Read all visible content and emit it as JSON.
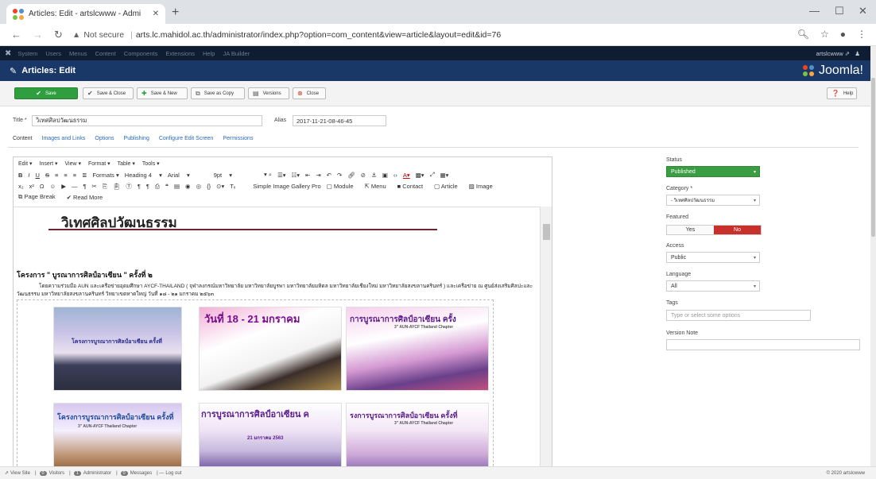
{
  "browser": {
    "tab_title": "Articles: Edit - artslcwww - Admi",
    "new_tab": "+",
    "not_secure": "Not secure",
    "url": "arts.lc.mahidol.ac.th/administrator/index.php?option=com_content&view=article&layout=edit&id=76"
  },
  "jnav": {
    "items": [
      "System",
      "Users",
      "Menus",
      "Content",
      "Components",
      "Extensions",
      "Help",
      "JA Builder"
    ],
    "user": "artslcwww"
  },
  "header": {
    "title": "Articles: Edit",
    "brand": "Joomla!"
  },
  "toolbar": {
    "save": "Save",
    "save_close": "Save & Close",
    "save_new": "Save & New",
    "save_copy": "Save as Copy",
    "versions": "Versions",
    "close": "Close",
    "help": "Help"
  },
  "form": {
    "title_label": "Title *",
    "title_value": "วิเทศศิลปวัฒนธรรม",
    "alias_label": "Alias",
    "alias_value": "2017-11-21-08-46-45"
  },
  "tabs": [
    "Content",
    "Images and Links",
    "Options",
    "Publishing",
    "Configure Edit Screen",
    "Permissions"
  ],
  "editor": {
    "menubar": [
      "Edit ▾",
      "Insert ▾",
      "View ▾",
      "Format ▾",
      "Table ▾",
      "Tools ▾"
    ],
    "formats": "Formats ▾",
    "heading": "Heading 4",
    "font": "Arial",
    "size": "9pt",
    "btn_gallery": "Simple Image Gallery Pro",
    "btn_module": "Module",
    "btn_menu": "Menu",
    "btn_contact": "Contact",
    "btn_article": "Article",
    "btn_image": "Image",
    "btn_pagebreak": "Page Break",
    "btn_readmore": "Read More"
  },
  "content": {
    "heading": "วิเทศศิลปวัฒนธรรม",
    "subheading": "โครงการ \" บูรณาการศิลป์อาเซียน \" ครั้งที่ ๒",
    "paragraph": "โดยความร่วมมือ AUN และเครือข่ายอุดมศึกษา AYCF-THAILAND ( จุฬาลงกรณ์มหาวิทยาลัย มหาวิทยาลัยบูรพา มหาวิทยาลัยมหิดล มหาวิทยาลัยเชียงใหม่ มหาวิทยาลัยสงขลานครินทร์ ) และเครือข่าย ณ ศูนย์ส่งเสริมศิลปะและวัฒนธรรม มหาวิทยาลัยสงขลานครินทร์ วิทยาเขตหาดใหญ่ วันที่ ๑๘ - ๒๑ มกราคม ๒๕๖๓",
    "photo_texts": [
      "โครงการบูรณาการศิลป์อาเซียน ครั้งที่",
      "วันที่ 18 - 21 มกราคม",
      "การบูรณาการศิลป์อาเซียน ครั้ง",
      "โครงการบูรณาการศิลป์อาเซียน ครั้งที่",
      "การบูรณาการศิลป์อาเซียน ค",
      "รงการบูรณาการศิลป์อาเซียน ครั้งที่"
    ],
    "photo_subtexts": [
      "",
      "",
      "3\" AUN-AYCF Thailand Chapter",
      "3\" AUN-AYCF Thailand Chapter",
      "21 มกราคม 2563",
      "3\" AUN-AYCF Thailand Chapter"
    ]
  },
  "side": {
    "status_label": "Status",
    "status_value": "Published",
    "category_label": "Category *",
    "category_value": "- วิเทศศิลปวัฒนธรรม",
    "featured_label": "Featured",
    "featured_yes": "Yes",
    "featured_no": "No",
    "access_label": "Access",
    "access_value": "Public",
    "language_label": "Language",
    "language_value": "All",
    "tags_label": "Tags",
    "tags_placeholder": "Type or select some options",
    "version_label": "Version Note"
  },
  "statusbar": {
    "view_site": "View Site",
    "visitors": "Visitors",
    "visitors_count": "0",
    "admin": "Administrator",
    "admin_count": "1",
    "messages": "Messages",
    "messages_count": "0",
    "logout": "Log out",
    "copyright": "© 2020 artslcwww"
  },
  "colors": {
    "save_green": "#2f9e3f",
    "header_blue": "#1a3867",
    "nav_dark": "#0f1d33",
    "no_red": "#c8312b"
  }
}
